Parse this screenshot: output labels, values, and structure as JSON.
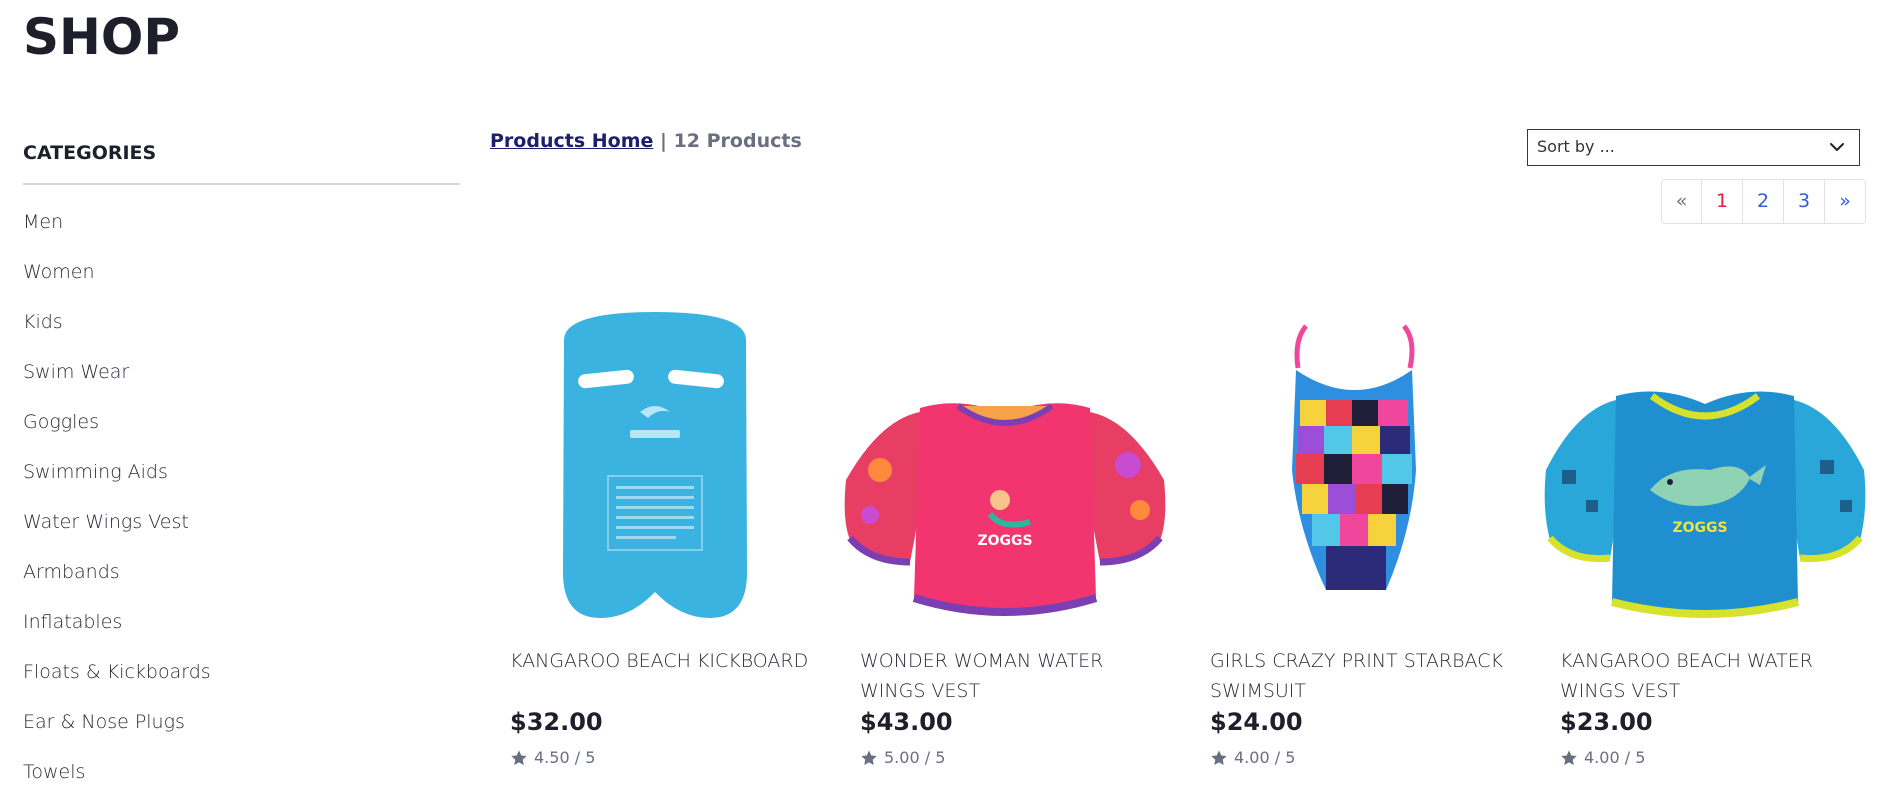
{
  "page": {
    "title": "SHOP"
  },
  "sidebar": {
    "heading": "CATEGORIES",
    "items": [
      {
        "label": "Men"
      },
      {
        "label": "Women"
      },
      {
        "label": "Kids"
      },
      {
        "label": "Swim Wear"
      },
      {
        "label": "Goggles"
      },
      {
        "label": "Swimming Aids"
      },
      {
        "label": "Water Wings Vest"
      },
      {
        "label": "Armbands"
      },
      {
        "label": "Inflatables"
      },
      {
        "label": "Floats & Kickboards"
      },
      {
        "label": "Ear & Nose Plugs"
      },
      {
        "label": "Towels"
      }
    ]
  },
  "breadcrumb": {
    "home": "Products Home",
    "separator": " | ",
    "count": "12 Products"
  },
  "sort": {
    "label": "Sort by ...",
    "icon": "chevron-down-icon"
  },
  "pagination": {
    "prev": "«",
    "pages": [
      "1",
      "2",
      "3"
    ],
    "next": "»",
    "active_page": "1",
    "active_color": "#e4213d",
    "link_color": "#2f5fd8"
  },
  "products": [
    {
      "name": "KANGAROO BEACH KICKBOARD",
      "price": "$32.00",
      "rating": "4.50 / 5",
      "icon": "star-icon"
    },
    {
      "name": "WONDER WOMAN WATER WINGS VEST",
      "price": "$43.00",
      "rating": "5.00 / 5",
      "icon": "star-icon"
    },
    {
      "name": "GIRLS CRAZY PRINT STARBACK SWIMSUIT",
      "price": "$24.00",
      "rating": "4.00 / 5",
      "icon": "star-icon"
    },
    {
      "name": "KANGAROO BEACH WATER WINGS VEST",
      "price": "$23.00",
      "rating": "4.00 / 5",
      "icon": "star-icon"
    }
  ],
  "colors": {
    "brand_dark": "#1e1f2a",
    "breadcrumb_link": "#1d1f6b",
    "muted": "#6a6f80"
  }
}
